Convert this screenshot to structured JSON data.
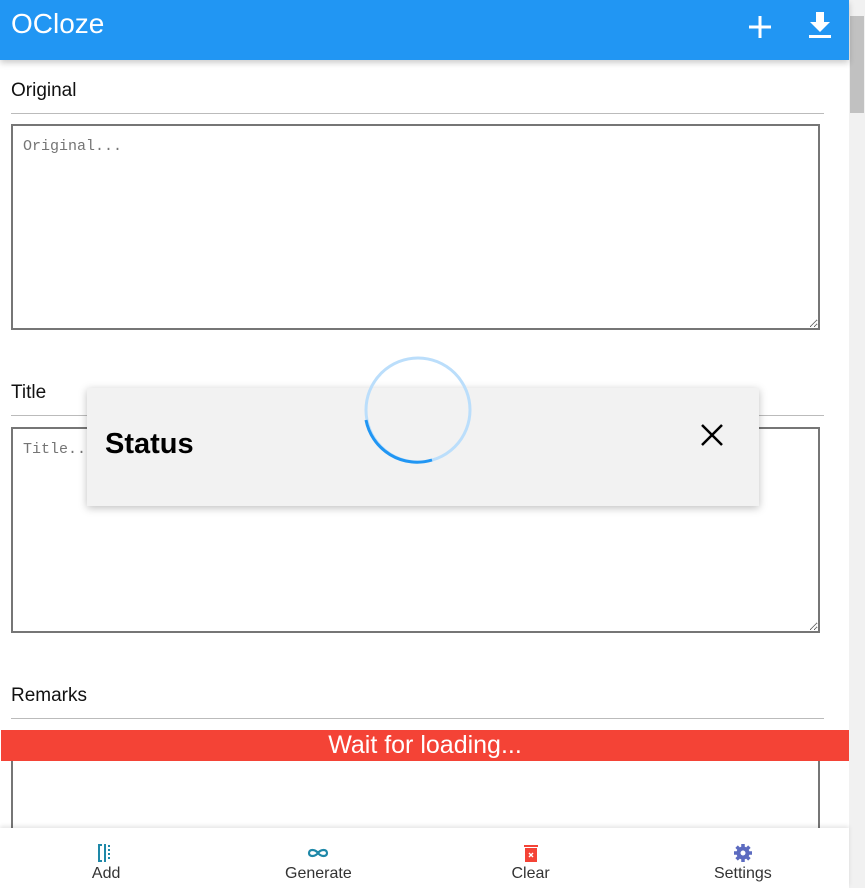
{
  "app": {
    "title": "OCloze"
  },
  "header": {
    "add_icon": "plus-icon",
    "download_icon": "download-icon"
  },
  "sections": [
    {
      "label": "Original",
      "placeholder": "Original..."
    },
    {
      "label": "Title",
      "placeholder": "Title..."
    },
    {
      "label": "Remarks",
      "placeholder": ""
    }
  ],
  "banner": {
    "text": "Wait for loading..."
  },
  "dialog": {
    "title": "Status"
  },
  "nav": [
    {
      "label": "Add",
      "color": "#1e88a8"
    },
    {
      "label": "Generate",
      "color": "#1e88a8"
    },
    {
      "label": "Clear",
      "color": "#f44336"
    },
    {
      "label": "Settings",
      "color": "#5c6bc0"
    }
  ]
}
